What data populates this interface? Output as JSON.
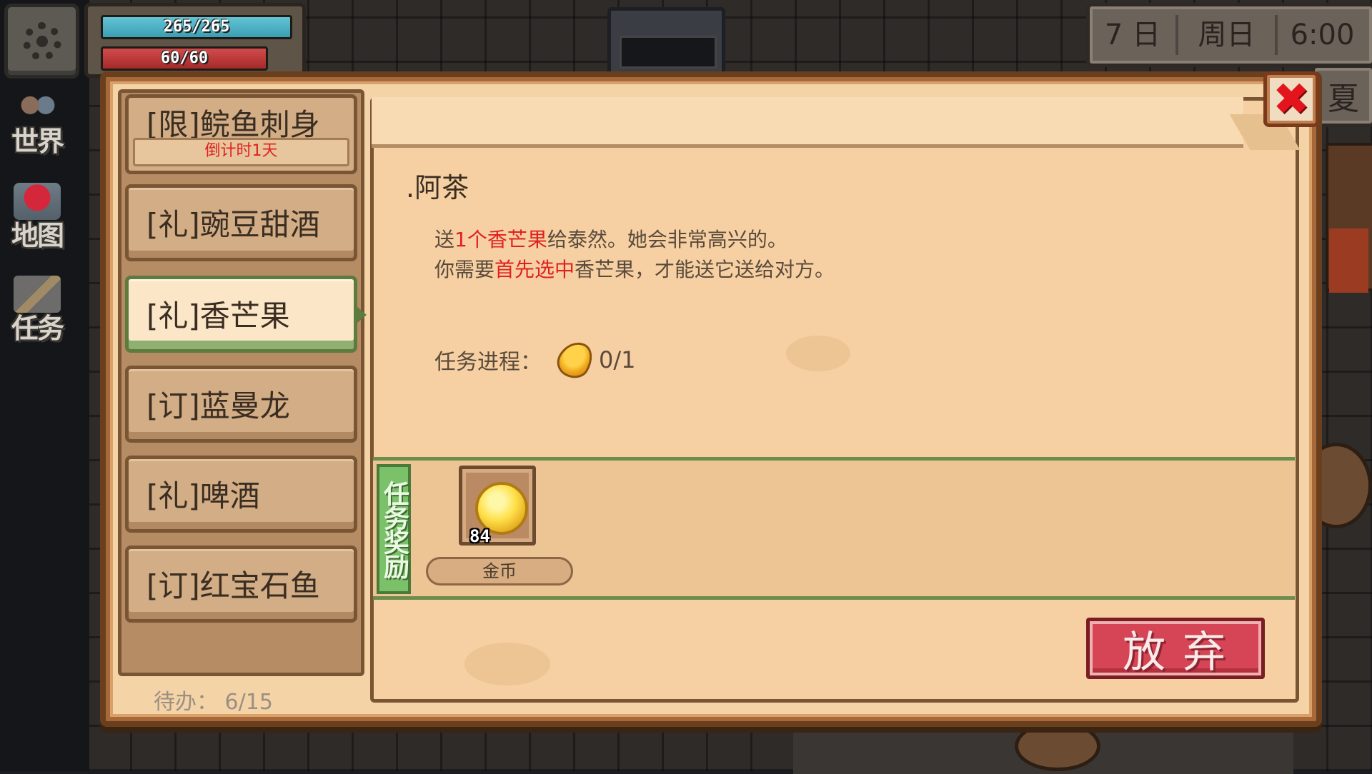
{
  "hud": {
    "hp": "265/265",
    "sp": "60/60",
    "date": {
      "day": "7 日",
      "weekday": "周日",
      "time": "6:00"
    },
    "season": "夏",
    "side_nav": [
      {
        "label": "世界",
        "icon": "world-icon"
      },
      {
        "label": "地图",
        "icon": "map-icon"
      },
      {
        "label": "任务",
        "icon": "task-icon"
      }
    ]
  },
  "quest_list": {
    "items": [
      {
        "label": "[限]鲩鱼刺身",
        "sub": "倒计时1天",
        "active": false
      },
      {
        "label": "[礼]豌豆甜酒",
        "active": false
      },
      {
        "label": "[礼]香芒果",
        "active": true
      },
      {
        "label": "[订]蓝曼龙",
        "active": false
      },
      {
        "label": "[礼]啤酒",
        "active": false
      },
      {
        "label": "[订]红宝石鱼",
        "active": false
      }
    ],
    "todo": "待办： 6/15"
  },
  "detail": {
    "npc": ".阿茶",
    "line1": {
      "pre": "送",
      "hl": "1个香芒果",
      "post": "给泰然。她会非常高兴的。"
    },
    "line2": {
      "pre": "你需要",
      "hl": "首先选中",
      "post": "香芒果，才能送它送给对方。"
    },
    "progress_label": "任务进程：",
    "progress_value": "0/1",
    "reward_tag": "任务奖励",
    "rewards": [
      {
        "name": "金币",
        "count": "84",
        "icon": "coin-icon"
      }
    ],
    "abandon_label": "放弃",
    "close_icon": "close-icon"
  },
  "colors": {
    "highlight": "#e02020",
    "abandon": "#d64555",
    "reward_tag": "#7bc16a"
  }
}
